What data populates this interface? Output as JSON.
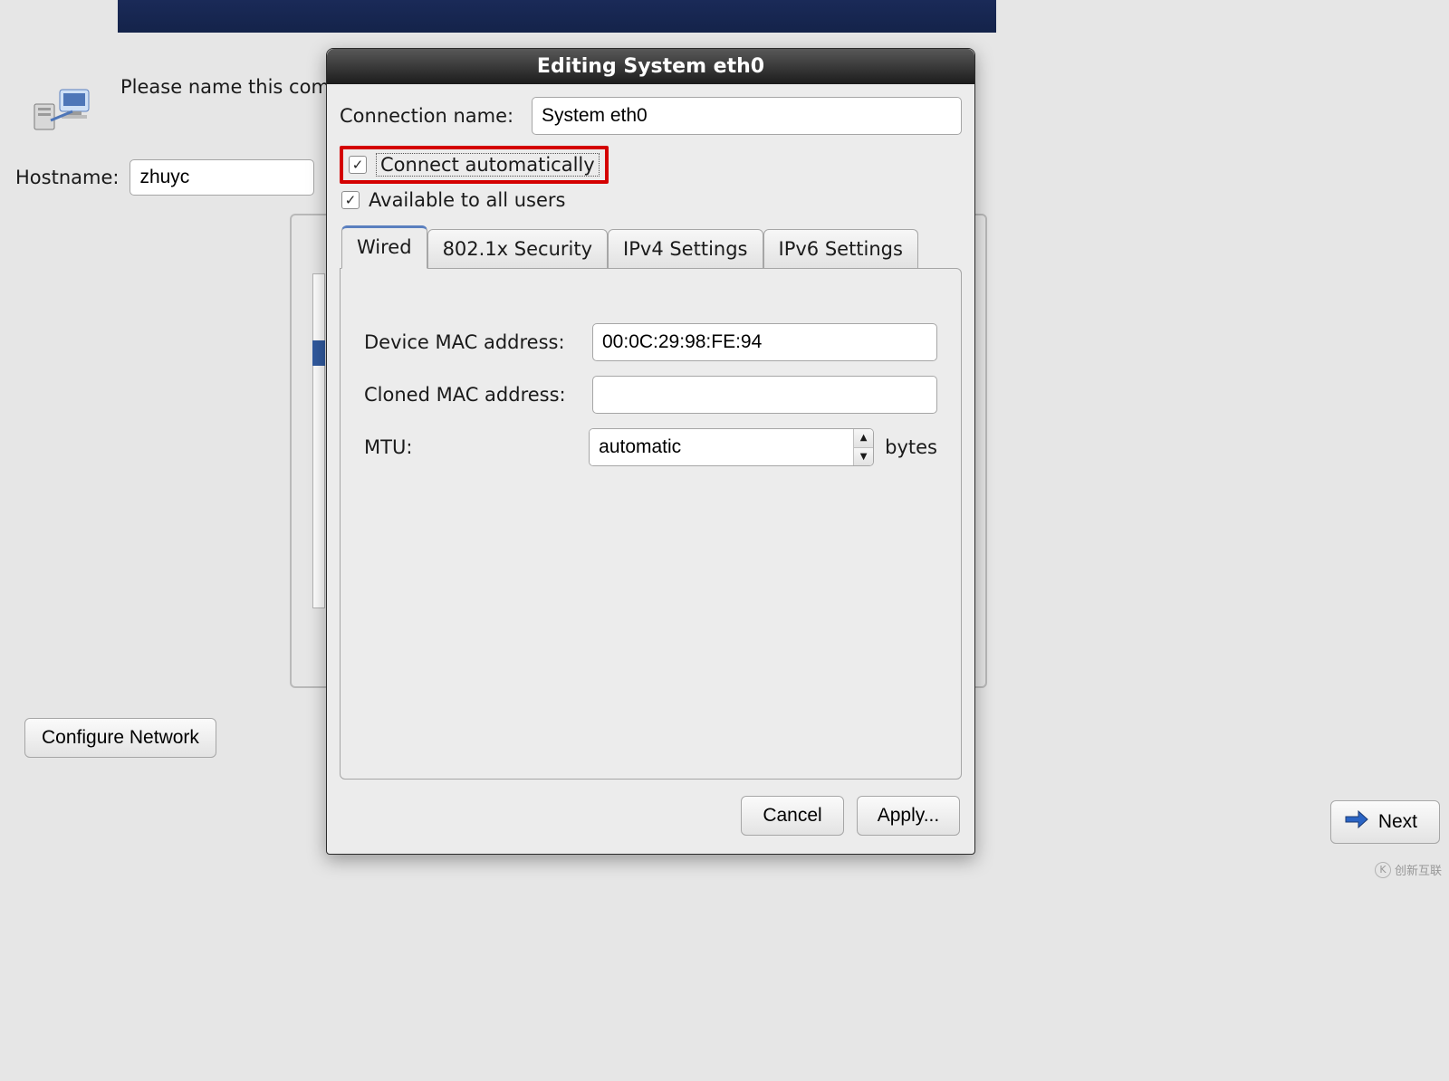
{
  "header": {
    "topbar_color": "#16295a"
  },
  "intro": "Please name this computer. The hostname identifies the computer on the network.",
  "hostname": {
    "label": "Hostname:",
    "value": "zhuyc"
  },
  "configure_label": "Configure Network",
  "next_label": "Next",
  "dialog": {
    "title": "Editing System eth0",
    "connection_label": "Connection name:",
    "connection_value": "System eth0",
    "connect_auto_label": "Connect automatically",
    "connect_auto_checked": true,
    "available_all_label": "Available to all users",
    "available_all_checked": true,
    "tabs": [
      "Wired",
      "802.1x Security",
      "IPv4 Settings",
      "IPv6 Settings"
    ],
    "active_tab": 0,
    "wired": {
      "device_mac_label": "Device MAC address:",
      "device_mac_value": "00:0C:29:98:FE:94",
      "cloned_mac_label": "Cloned MAC address:",
      "cloned_mac_value": "",
      "mtu_label": "MTU:",
      "mtu_value": "automatic",
      "mtu_unit": "bytes"
    },
    "buttons": {
      "cancel": "Cancel",
      "apply": "Apply..."
    }
  },
  "watermark": "创新互联"
}
